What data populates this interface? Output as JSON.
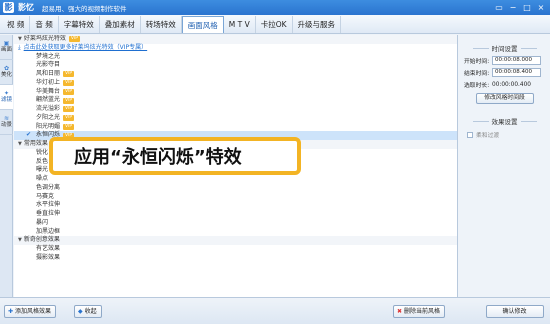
{
  "titlebar": {
    "logo": "影",
    "app_name": "影忆",
    "slogan": "超易用、强大的视频制作软件",
    "buttons": [
      "▭",
      "−",
      "□",
      "×"
    ]
  },
  "menu": {
    "tabs": [
      "视 频",
      "音 频",
      "字幕特效",
      "叠加素材",
      "转场特效",
      "画面风格",
      "M T V",
      "卡拉OK",
      "升级与服务"
    ],
    "active_index": 5
  },
  "left_tabs": [
    {
      "label": "画面",
      "icon": "▣",
      "active": false
    },
    {
      "label": "美化",
      "icon": "✿",
      "active": false
    },
    {
      "label": "滤镜",
      "icon": "✦",
      "active": true
    },
    {
      "label": "动景",
      "icon": "≋",
      "active": false
    }
  ],
  "list": {
    "group1_title": "好莱坞炫光特效",
    "vip_badge": "VIP",
    "link_text": "点击此处获取更多好莱坞炫光特效（VIP专属）",
    "group1_items": [
      {
        "label": "梦境之光",
        "vip": false
      },
      {
        "label": "光影夺目",
        "vip": false
      },
      {
        "label": "风和日丽",
        "vip": true
      },
      {
        "label": "华灯初上",
        "vip": true
      },
      {
        "label": "华美舞台",
        "vip": true
      },
      {
        "label": "翩然蓝光",
        "vip": true
      },
      {
        "label": "流光溢彩",
        "vip": true
      },
      {
        "label": "夕阳之光",
        "vip": true
      },
      {
        "label": "阳光明媚",
        "vip": true
      }
    ],
    "selected_item": {
      "label": "永恒闪烁",
      "vip": true
    },
    "group2_title": "常用效果",
    "group2_items": [
      "锐化",
      "反色",
      "曝光",
      "噪点",
      "色调分离",
      "马赛克",
      "水平拉伸",
      "垂直拉伸",
      "暴闪",
      "加黑边框"
    ],
    "group3_title": "新奇创意效果",
    "group3_items": [
      "有艺效果",
      "摄影效果"
    ]
  },
  "callout": {
    "text": "应用“永恒闪烁”特效"
  },
  "right_panel": {
    "time_title": "时间设置",
    "start_label": "开始时间:",
    "start_value": "00:00:08.000",
    "end_label": "结束时间:",
    "end_value": "00:00:08.400",
    "duration_label": "选取时长:",
    "duration_value": "00:00:00.400",
    "modify_time_button": "修改风格时间段",
    "effect_title": "效果设置",
    "soft_transition_label": "柔和过渡",
    "confirm_button": "确认修改"
  },
  "bottom": {
    "add_button": "添加风格效果",
    "collapse_button": "收起",
    "delete_button": "删除当前风格"
  }
}
